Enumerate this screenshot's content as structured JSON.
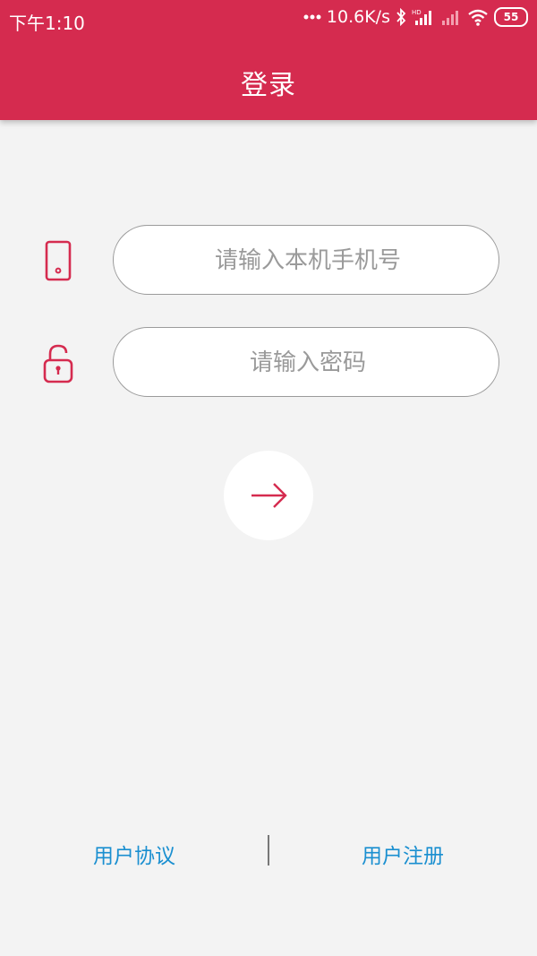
{
  "status_bar": {
    "time": "下午1:10",
    "net_speed": "10.6K/s",
    "battery": "55",
    "icons": [
      "more-dots-icon",
      "bluetooth-icon",
      "hd-signal-icon",
      "signal-icon",
      "wifi-icon",
      "battery-icon"
    ]
  },
  "header": {
    "title": "登录"
  },
  "form": {
    "phone_placeholder": "请输入本机手机号",
    "password_placeholder": "请输入密码",
    "phone_icon": "phone-icon",
    "lock_icon": "unlock-icon",
    "submit_icon": "arrow-right-icon"
  },
  "footer": {
    "agreement_label": "用户协议",
    "register_label": "用户注册"
  },
  "colors": {
    "brand": "#d52b4f",
    "link": "#1a8fd0",
    "background": "#f3f3f3"
  }
}
